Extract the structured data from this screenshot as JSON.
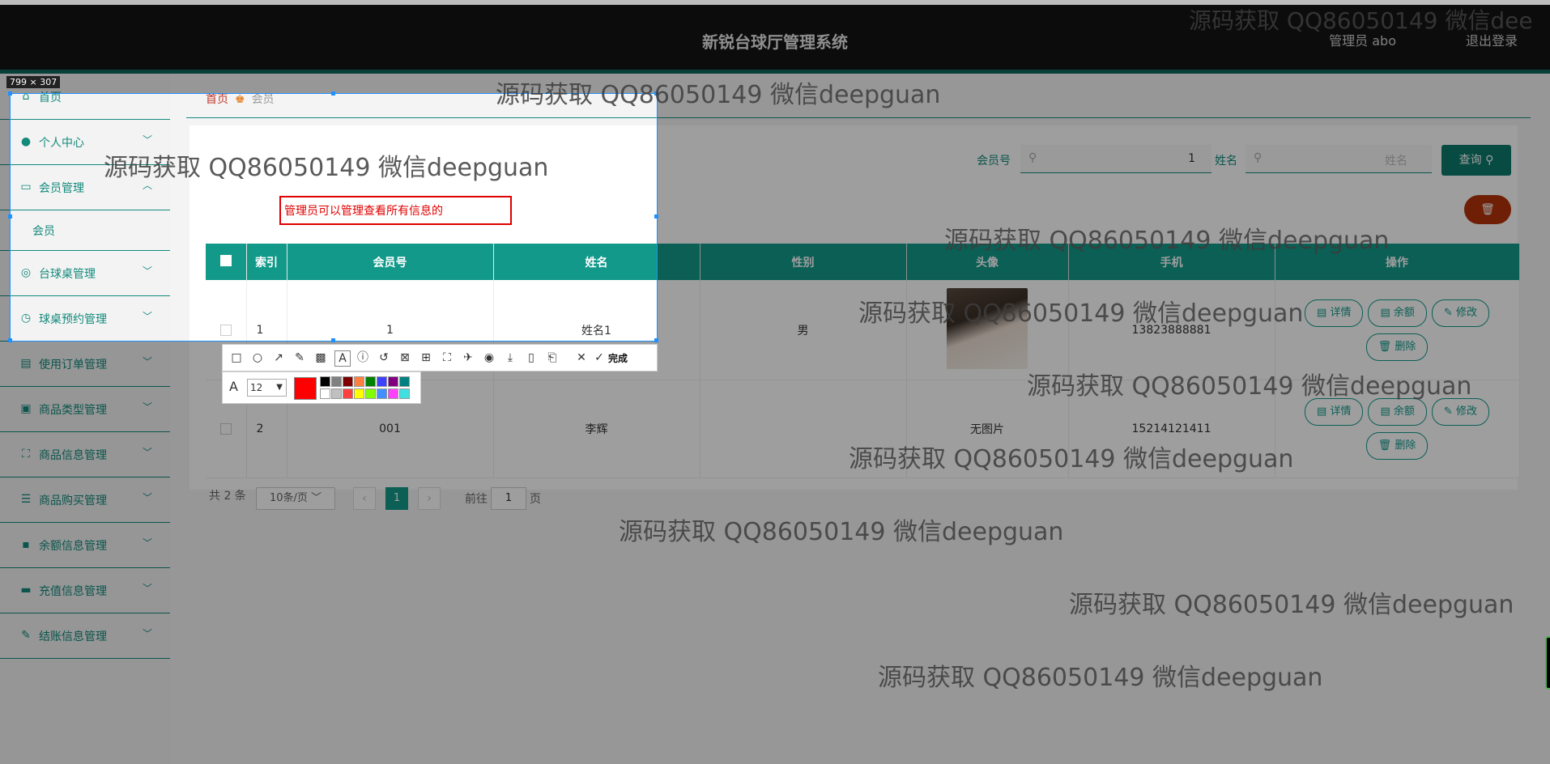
{
  "header": {
    "title": "新锐台球厅管理系统",
    "user": "管理员 abo",
    "logout": "退出登录"
  },
  "sidebar": {
    "items": [
      {
        "label": "首页"
      },
      {
        "label": "个人中心"
      },
      {
        "label": "会员管理"
      },
      {
        "label": "会员"
      },
      {
        "label": "台球桌管理"
      },
      {
        "label": "球桌预约管理"
      },
      {
        "label": "使用订单管理"
      },
      {
        "label": "商品类型管理"
      },
      {
        "label": "商品信息管理"
      },
      {
        "label": "商品购买管理"
      },
      {
        "label": "余额信息管理"
      },
      {
        "label": "充值信息管理"
      },
      {
        "label": "结账信息管理"
      }
    ]
  },
  "breadcrumb": {
    "home": "首页",
    "current": "会员"
  },
  "search": {
    "member_label": "会员号",
    "member_value": "1",
    "name_label": "姓名",
    "name_placeholder": "姓名",
    "query_button": "查询"
  },
  "table": {
    "headers": [
      "索引",
      "会员号",
      "姓名",
      "性别",
      "头像",
      "手机",
      "操作"
    ],
    "rows": [
      {
        "index": "1",
        "member_no": "1",
        "name": "姓名1",
        "gender": "男",
        "avatar": "",
        "phone": "13823888881"
      },
      {
        "index": "2",
        "member_no": "001",
        "name": "李辉",
        "gender": "",
        "avatar": "无图片",
        "phone": "15214121411"
      }
    ],
    "actions": {
      "detail": "详情",
      "balance": "余额",
      "edit": "修改",
      "delete": "删除"
    }
  },
  "pagination": {
    "total": "共 2 条",
    "page_size": "10条/页",
    "current_page": "1",
    "goto_label": "前往",
    "goto_value": "1",
    "page_suffix": "页"
  },
  "screenshot_tool": {
    "size_label": "799 × 307",
    "annotation_text": "管理员可以管理查看所有信息的",
    "done_label": "完成",
    "font_size": "12",
    "current_color": "#ff0000",
    "palette": [
      "#000000",
      "#808080",
      "#800000",
      "#ff8040",
      "#008000",
      "#4040ff",
      "#800080",
      "#008080",
      "#ffffff",
      "#c0c0c0",
      "#ff4040",
      "#ffff00",
      "#80ff00",
      "#4090ff",
      "#ff40ff",
      "#40e0e0"
    ]
  },
  "watermark": "源码获取 QQ86050149 微信deepguan",
  "watermark_top": "源码获取 QQ86050149 微信dee"
}
